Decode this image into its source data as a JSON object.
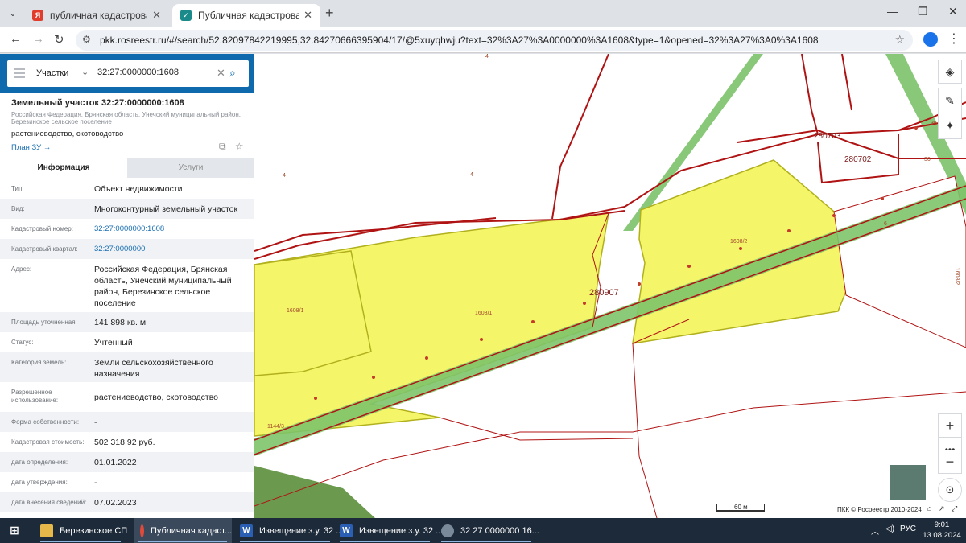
{
  "browser": {
    "tabs": [
      {
        "title": "публичная кадастровая карта",
        "active": false,
        "favicon": "yandex-icon"
      },
      {
        "title": "Публичная кадастровая карта",
        "active": true,
        "favicon": "rosreestr-icon"
      }
    ],
    "url": "pkk.rosreestr.ru/#/search/52.82097842219995,32.84270666395904/17/@5xuyqhwju?text=32%3A27%3A0000000%3A1608&type=1&opened=32%3A27%3A0%3A1608"
  },
  "search": {
    "type_label": "Участки",
    "query": "32:27:0000000:1608"
  },
  "object": {
    "title": "Земельный участок 32:27:0000000:1608",
    "address_short": "Российская Федерация, Брянская область, Унечский муниципальный район, Березинское сельское поселение",
    "usage": "растениеводство, скотоводство",
    "plan_link": "План ЗУ →"
  },
  "info_tabs": [
    "Информация",
    "Услуги"
  ],
  "fields": [
    {
      "label": "Тип:",
      "value": "Объект недвижимости"
    },
    {
      "label": "Вид:",
      "value": "Многоконтурный земельный участок"
    },
    {
      "label": "Кадастровый номер:",
      "value": "32:27:0000000:1608",
      "link": true
    },
    {
      "label": "Кадастровый квартал:",
      "value": "32:27:0000000",
      "link": true
    },
    {
      "label": "Адрес:",
      "value": "Российская Федерация, Брянская область, Унечский муниципальный район, Березинское сельское поселение"
    },
    {
      "label": "Площадь уточненная:",
      "value": "141 898 кв. м"
    },
    {
      "label": "Статус:",
      "value": "Учтенный"
    },
    {
      "label": "Категория земель:",
      "value": "Земли сельскохозяйственного назначения"
    },
    {
      "label": "Разрешенное использование:",
      "value": "растениеводство, скотоводство"
    },
    {
      "label": "Форма собственности:",
      "value": "-"
    },
    {
      "label": "Кадастровая стоимость:",
      "value": "502 318,92 руб."
    },
    {
      "label": "дата определения:",
      "value": "01.01.2022"
    },
    {
      "label": "дата утверждения:",
      "value": "-"
    },
    {
      "label": "дата внесения сведений:",
      "value": "07.02.2023"
    }
  ],
  "map": {
    "labels": {
      "quarter_main": "280907",
      "quarter_703": "280703",
      "quarter_702": "280702",
      "n4a": "4",
      "n4b": "4",
      "n4top": "4",
      "n6": "6",
      "n36a": "36",
      "n36b": "36",
      "c1": "1608/1",
      "c1b": "1608/1",
      "c2": "1608/2",
      "c2side": "1608/2",
      "p1144": "1144/3"
    },
    "scale": "60 м",
    "copyright": "ПКК © Росреестр 2010-2024",
    "colors": {
      "parcel_fill": "#f5f56a",
      "parcel_border": "#b1b01d",
      "boundary": "#b01313",
      "road": "#7ec46a",
      "quarter_text": "#7b1b1b"
    }
  },
  "taskbar": {
    "items": [
      {
        "label": "Березинское СП",
        "icon": "folder-icon"
      },
      {
        "label": "Публичная кадаст...",
        "icon": "chrome-icon"
      },
      {
        "label": "Извещение з.у. 32 ...",
        "icon": "word-icon"
      },
      {
        "label": "Извещение з.у. 32 ...",
        "icon": "word-icon"
      },
      {
        "label": "32  27  0000000  16...",
        "icon": "image-viewer-icon"
      }
    ],
    "lang": "РУС",
    "time": "9:01",
    "date": "13.08.2024"
  }
}
